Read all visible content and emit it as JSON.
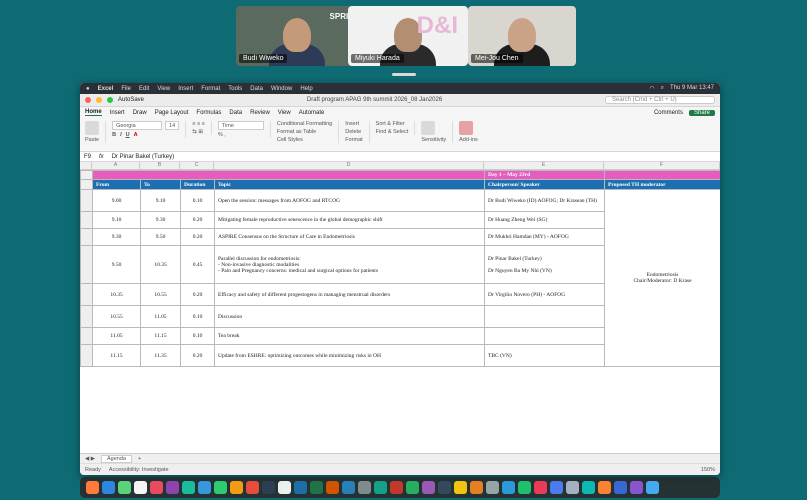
{
  "meeting": {
    "participants": [
      {
        "name": "Budi Wiweko"
      },
      {
        "name": "Miyuki Harada"
      },
      {
        "name": "Mei-Jou Chen"
      }
    ],
    "logo_text": "SPRIN"
  },
  "menubar": {
    "app": "Excel",
    "items": [
      "File",
      "Edit",
      "View",
      "Insert",
      "Format",
      "Tools",
      "Data",
      "Window",
      "Help"
    ],
    "clock": "Thu 9 Mar 13:47"
  },
  "titlebar": {
    "autosave": "AutoSave",
    "title": "Draft program APAG 9th summit 2026_08 Jan2026",
    "search_placeholder": "Search (Cmd + Ctrl + U)"
  },
  "ribbon_tabs": {
    "items": [
      "Home",
      "Insert",
      "Draw",
      "Page Layout",
      "Formulas",
      "Data",
      "Review",
      "View",
      "Automate"
    ],
    "comments": "Comments",
    "share": "Share"
  },
  "ribbon": {
    "paste": "Paste",
    "font": "Georgia",
    "size": "14",
    "number_format": "Time",
    "conditional": "Conditional Formatting",
    "format_table": "Format as Table",
    "cell_styles": "Cell Styles",
    "insert": "Insert",
    "delete": "Delete",
    "format": "Format",
    "sort": "Sort & Filter",
    "find": "Find & Select",
    "sensitivity": "Sensitivity",
    "addins": "Add-ins"
  },
  "formula_bar": {
    "cell_ref": "F9",
    "value": "Dr Pinar Bakel (Turkey)"
  },
  "columns": [
    "A",
    "B",
    "C",
    "D",
    "E",
    "F"
  ],
  "sheet": {
    "day_banner": "Day 1 – May 23rd",
    "headers": [
      "From",
      "To",
      "Duration",
      "Topic",
      "Chairperson/ Speaker",
      "Proposed TH moderator"
    ],
    "rows": [
      {
        "from": "9.00",
        "to": "9.10",
        "dur": "0.10",
        "topic": "Open the session: messages from AOFOG and RTCOG",
        "speaker": "Dr Budi Wiweko (ID) AOFOG; Dr Krasean (TH)"
      },
      {
        "from": "9.10",
        "to": "9.30",
        "dur": "0.20",
        "topic": "Mitigating female reproductive senescence in the global demographic shift",
        "speaker": "Dr Huang Zheng Wei (SG)"
      },
      {
        "from": "9.30",
        "to": "9.50",
        "dur": "0.20",
        "topic": "ASPIRE Consensus on the Structure of Care in Endometriosis",
        "speaker": "Dr Mukhri Hamdan (MY) - AOFOG"
      },
      {
        "from": "9.50",
        "to": "10.35",
        "dur": "0.45",
        "topic": "Parallel discussion for endometriosis:\n- Non-invasive diagnostic modalities\n- Pain and Pregnancy concerns: medical and surgical options for patients",
        "speaker": "Dr Pinar Bakel (Turkey)\n\nDr Nguyen Ba My Nhi (VN)"
      },
      {
        "from": "10.35",
        "to": "10.55",
        "dur": "0.20",
        "topic": "Efficacy and safety of different progestogens in managing menstrual disorders",
        "speaker": "Dr Virgilio Novero (PH) - AOFOG"
      },
      {
        "from": "10.55",
        "to": "11.05",
        "dur": "0.10",
        "topic": "Discussion",
        "speaker": ""
      },
      {
        "from": "11.05",
        "to": "11.15",
        "dur": "0.10",
        "topic": "Tea break",
        "speaker": ""
      },
      {
        "from": "11.15",
        "to": "11.35",
        "dur": "0.20",
        "topic": "Update from ESHRE: optimizing outcomes while minimizing risks in OH",
        "speaker": "TBC (VN)"
      }
    ],
    "moderator": "Endometriosis\nChair/Moderator: D Krase"
  },
  "statusbar": {
    "sheet_tab": "Agenda",
    "ready": "Ready",
    "accessibility": "Accessibility: Investigate",
    "zoom": "150%"
  }
}
